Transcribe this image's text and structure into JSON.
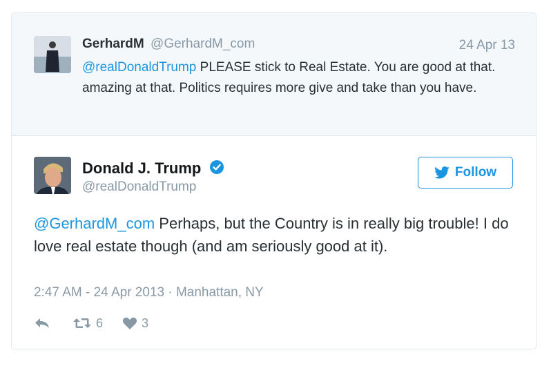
{
  "parent_tweet": {
    "author_name": "GerhardM",
    "author_handle": "@GerhardM_com",
    "date": "24 Apr 13",
    "mention": "@realDonaldTrump",
    "text": " PLEASE stick to Real Estate. You are good at that. amazing at that. Politics requires more give and take than you have."
  },
  "tweet": {
    "author_name": "Donald J. Trump",
    "author_handle": "@realDonaldTrump",
    "verified_icon": "verified-badge-icon",
    "follow_label": "Follow",
    "mention": "@GerhardM_com",
    "text": " Perhaps, but the Country is in really big trouble! I do love real estate though (and am seriously good at it).",
    "meta": "2:47 AM - 24 Apr 2013 · Manhattan, NY",
    "retweet_count": "6",
    "like_count": "3"
  },
  "colors": {
    "accent": "#1b95e0",
    "muted": "#8899a6",
    "parent_bg": "#f5f8fa"
  }
}
